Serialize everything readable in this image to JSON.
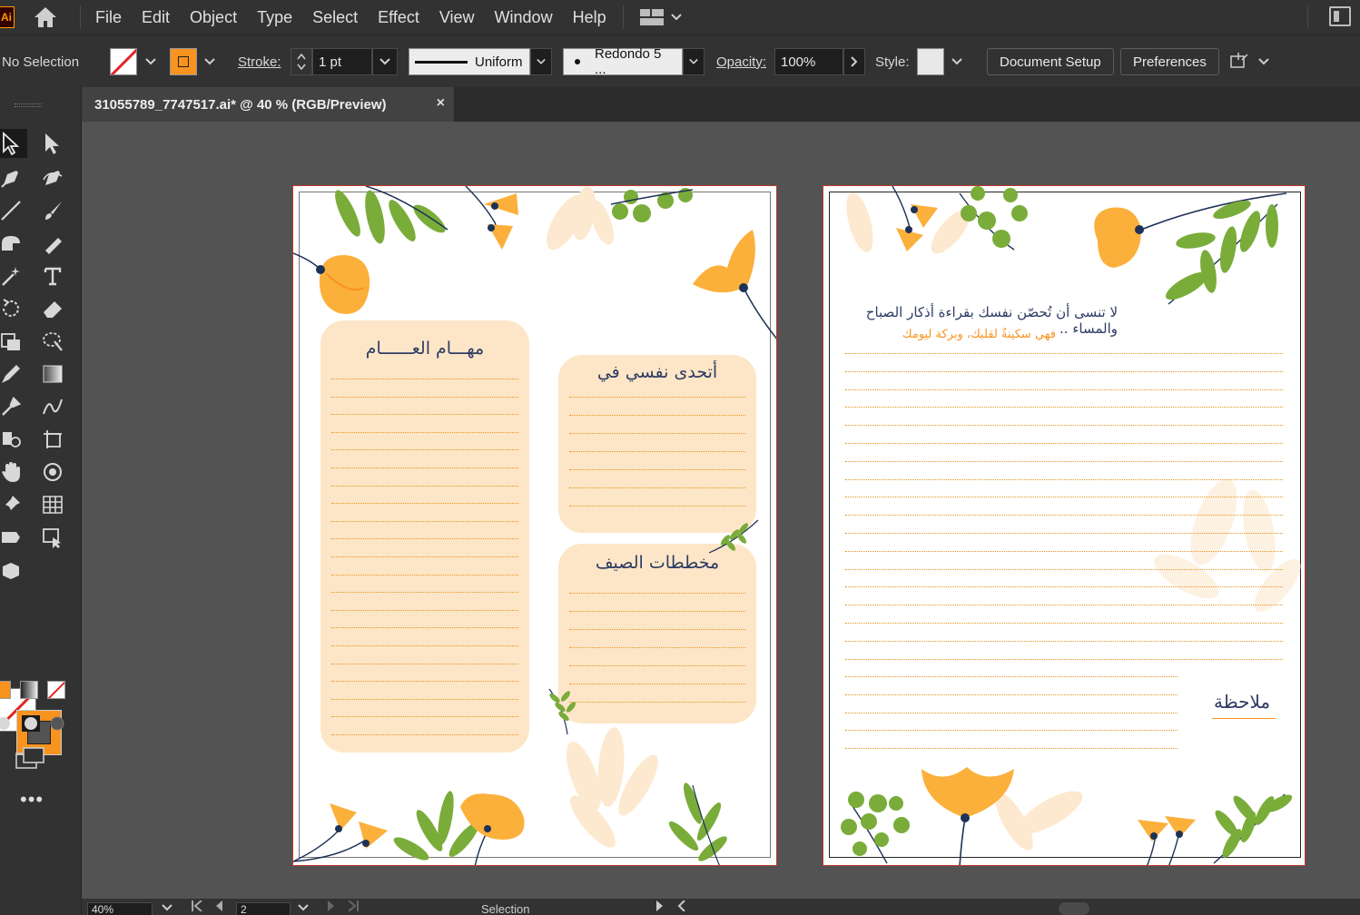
{
  "app": {
    "logo_text": "Ai"
  },
  "menu": {
    "items": [
      "File",
      "Edit",
      "Object",
      "Type",
      "Select",
      "Effect",
      "View",
      "Window",
      "Help"
    ]
  },
  "control_bar": {
    "selection_label": "No Selection",
    "stroke_label": "Stroke:",
    "stroke_weight": "1 pt",
    "stroke_profile": "Uniform",
    "brush": "Redondo 5 ...",
    "opacity_label": "Opacity:",
    "opacity_value": "100%",
    "style_label": "Style:",
    "document_setup": "Document Setup",
    "preferences": "Preferences",
    "fill_color": "none",
    "stroke_color": "#f7931e"
  },
  "document": {
    "tab_title": "31055789_7747517.ai* @ 40 % (RGB/Preview)",
    "close_glyph": "×"
  },
  "artboard_left": {
    "card_tasks_title": "مهـــام العــــــام",
    "card_challenge_title": "أتحدى نفسي في",
    "card_plans_title": "مخططات الصيف"
  },
  "artboard_right": {
    "reminder_line1": "لا تنسى أن تُحصّن نفسك بقراءة أذكار الصباح والمساء ..",
    "reminder_line2": "فهي سكينةٌ لقلبك، وبركة ليومك",
    "note_label": "ملاحظة"
  },
  "status_bar": {
    "zoom": "40%",
    "artboard_number": "2",
    "current_tool": "Selection"
  },
  "colors": {
    "accent_orange": "#f7931e",
    "flower_yellow": "#fbb03b",
    "leaf_green": "#7aac3a",
    "navy": "#1e3257",
    "card_peach": "#fde6c7"
  }
}
